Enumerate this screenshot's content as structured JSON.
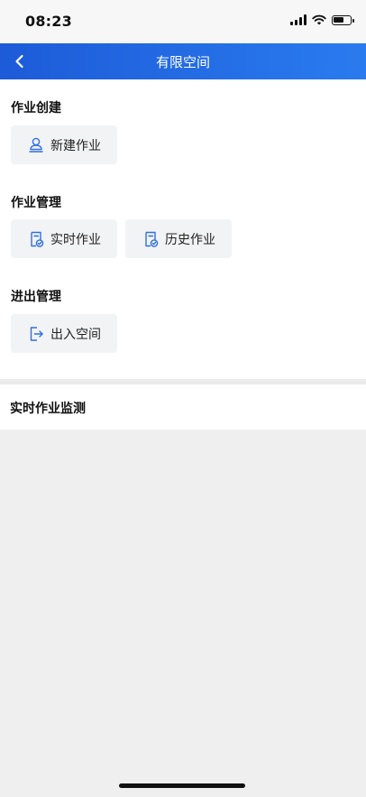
{
  "status_bar": {
    "time": "08:23"
  },
  "nav": {
    "title": "有限空间"
  },
  "sections": {
    "create": {
      "title": "作业创建",
      "new_job": "新建作业"
    },
    "manage": {
      "title": "作业管理",
      "realtime_job": "实时作业",
      "history_job": "历史作业"
    },
    "access": {
      "title": "进出管理",
      "enter_space": "出入空间"
    }
  },
  "monitor": {
    "title": "实时作业监测"
  },
  "colors": {
    "nav_start": "#1d5bd8",
    "nav_end": "#2a7bef",
    "icon_blue": "#2f6fe0",
    "tile_bg": "#f2f3f5"
  },
  "icons": {
    "back": "chevron-left-icon",
    "new_job": "worker-person-icon",
    "realtime_job": "document-check-icon",
    "history_job": "document-check-icon",
    "enter_space": "exit-arrow-icon"
  }
}
